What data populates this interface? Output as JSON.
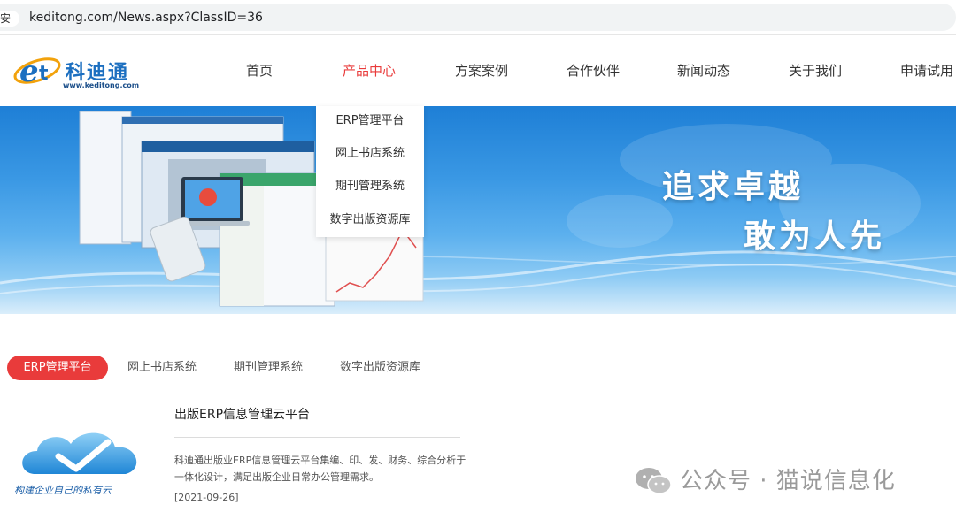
{
  "browser": {
    "secure_label": "安全",
    "url": "keditong.com/News.aspx?ClassID=36"
  },
  "header": {
    "logo_text": "科迪通",
    "logo_url": "www.keditong.com",
    "nav": [
      {
        "label": "首页"
      },
      {
        "label": "产品中心"
      },
      {
        "label": "方案案例"
      },
      {
        "label": "合作伙伴"
      },
      {
        "label": "新闻动态"
      },
      {
        "label": "关于我们"
      },
      {
        "label": "申请试用"
      }
    ],
    "active_color": "#e93b3b"
  },
  "dropdown": {
    "items": [
      {
        "label": "ERP管理平台"
      },
      {
        "label": "网上书店系统"
      },
      {
        "label": "期刊管理系统"
      },
      {
        "label": "数字出版资源库"
      }
    ]
  },
  "banner": {
    "slogan_line1": "追求卓越",
    "slogan_line2": "敢为人先"
  },
  "tabs": [
    {
      "label": "ERP管理平台"
    },
    {
      "label": "网上书店系统"
    },
    {
      "label": "期刊管理系统"
    },
    {
      "label": "数字出版资源库"
    }
  ],
  "article": {
    "thumb_caption": "构建企业自己的私有云",
    "title": "出版ERP信息管理云平台",
    "description": "科迪通出版业ERP信息管理云平台集编、印、发、财务、综合分析于一体化设计，满足出版企业日常办公管理需求。",
    "date": "[2021-09-26]"
  },
  "watermark": {
    "text": "公众号 · 猫说信息化"
  }
}
